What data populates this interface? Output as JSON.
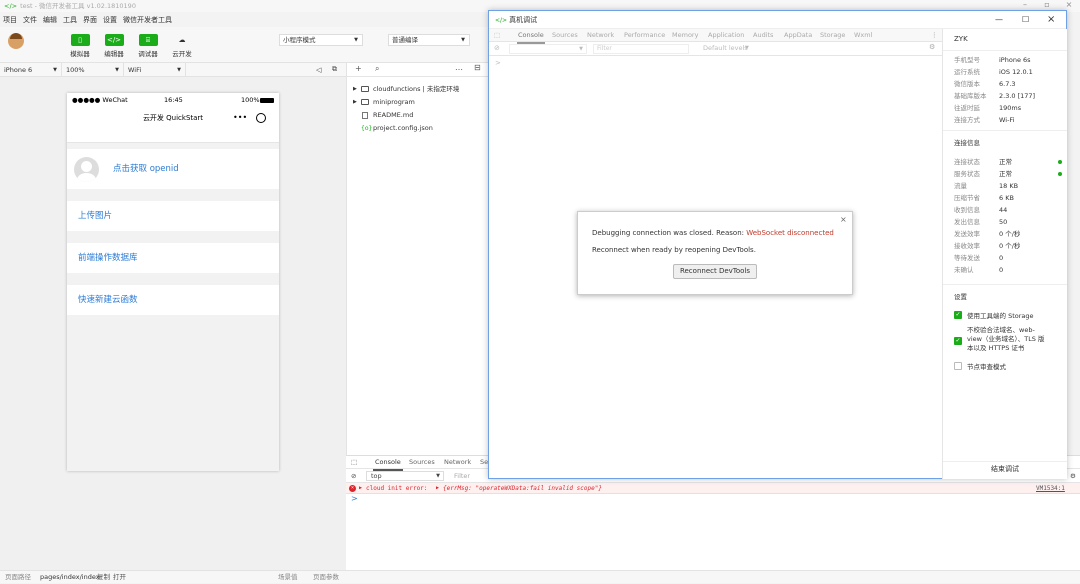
{
  "app": {
    "title": "test - 微信开发者工具 v1.02.1810190",
    "menu": [
      "项目",
      "文件",
      "编辑",
      "工具",
      "界面",
      "设置",
      "微信开发者工具"
    ],
    "toolbar": {
      "simulator": "模拟器",
      "editor": "编辑器",
      "debugger": "调试器",
      "cloud": "云开发",
      "mode": "小程序模式",
      "compile": "普通编译"
    }
  },
  "simulator_bar": {
    "device": "iPhone 6",
    "zoom": "100%",
    "network": "WiFi"
  },
  "phone": {
    "carrier": "●●●●● WeChat",
    "time": "16:45",
    "battery": "100%",
    "nav_title": "云开发 QuickStart",
    "capsule_more": "•••",
    "items": [
      "点击获取 openid",
      "上传图片",
      "前端操作数据库",
      "快速新建云函数"
    ]
  },
  "explorer": {
    "files": [
      {
        "name": "cloudfunctions | 未指定环境",
        "type": "folder"
      },
      {
        "name": "miniprogram",
        "type": "folder"
      },
      {
        "name": "README.md",
        "type": "file"
      },
      {
        "name": "project.config.json",
        "type": "json"
      }
    ]
  },
  "console": {
    "tabs": [
      "Console",
      "Sources",
      "Network",
      "Se"
    ],
    "context": "top",
    "filter_placeholder": "Filter",
    "error_label": "cloud init error:",
    "error_body": "{errMsg: \"operateWXData:fail invalid scope\"}",
    "error_source": "VM1534:1",
    "prompt": ">"
  },
  "footer": {
    "path_label": "页面路径",
    "path": "pages/index/index",
    "copy": "复制",
    "open": "打开",
    "scene": "场景值",
    "params": "页面参数"
  },
  "devtools": {
    "title": "真机调试",
    "tabs": [
      "Console",
      "Sources",
      "Network",
      "Performance",
      "Memory",
      "Application",
      "Audits",
      "AppData",
      "Storage",
      "Wxml"
    ],
    "filter_placeholder": "Filter",
    "levels": "Default levels",
    "prompt": ">",
    "side": {
      "user": "ZYK",
      "device_info": [
        {
          "k": "手机型号",
          "v": "iPhone 6s"
        },
        {
          "k": "运行系统",
          "v": "iOS 12.0.1"
        },
        {
          "k": "微信版本",
          "v": "6.7.3"
        },
        {
          "k": "基础库版本",
          "v": "2.3.0 [177]"
        },
        {
          "k": "往返时延",
          "v": "190ms"
        },
        {
          "k": "连接方式",
          "v": "Wi-Fi"
        }
      ],
      "conn_title": "连接信息",
      "conn_info": [
        {
          "k": "连接状态",
          "v": "正常",
          "dot": true
        },
        {
          "k": "服务状态",
          "v": "正常",
          "dot": true
        },
        {
          "k": "流量",
          "v": "18 KB"
        },
        {
          "k": "压缩节省",
          "v": "6 KB"
        },
        {
          "k": "收到信息",
          "v": "44"
        },
        {
          "k": "发出信息",
          "v": "50"
        },
        {
          "k": "发送效率",
          "v": "0 个/秒"
        },
        {
          "k": "接收效率",
          "v": "0 个/秒"
        },
        {
          "k": "等待发送",
          "v": "0"
        },
        {
          "k": "未确认",
          "v": "0"
        }
      ],
      "settings_title": "设置",
      "setting1": "使用工具端的 Storage",
      "setting2a": "不校验合法域名、web-",
      "setting2b": "view（业务域名）、TLS 版",
      "setting2c": "本以及 HTTPS 证书",
      "setting3": "节点审查模式",
      "end_button": "结束调试"
    },
    "dialog": {
      "line1_prefix": "Debugging connection was closed. Reason: ",
      "line1_reason": "WebSocket disconnected",
      "line2": "Reconnect when ready by reopening DevTools.",
      "button": "Reconnect DevTools",
      "close": "×"
    }
  },
  "colors": {
    "accent": "#1aad19",
    "link": "#2b7bd5",
    "error": "#d8262c"
  }
}
